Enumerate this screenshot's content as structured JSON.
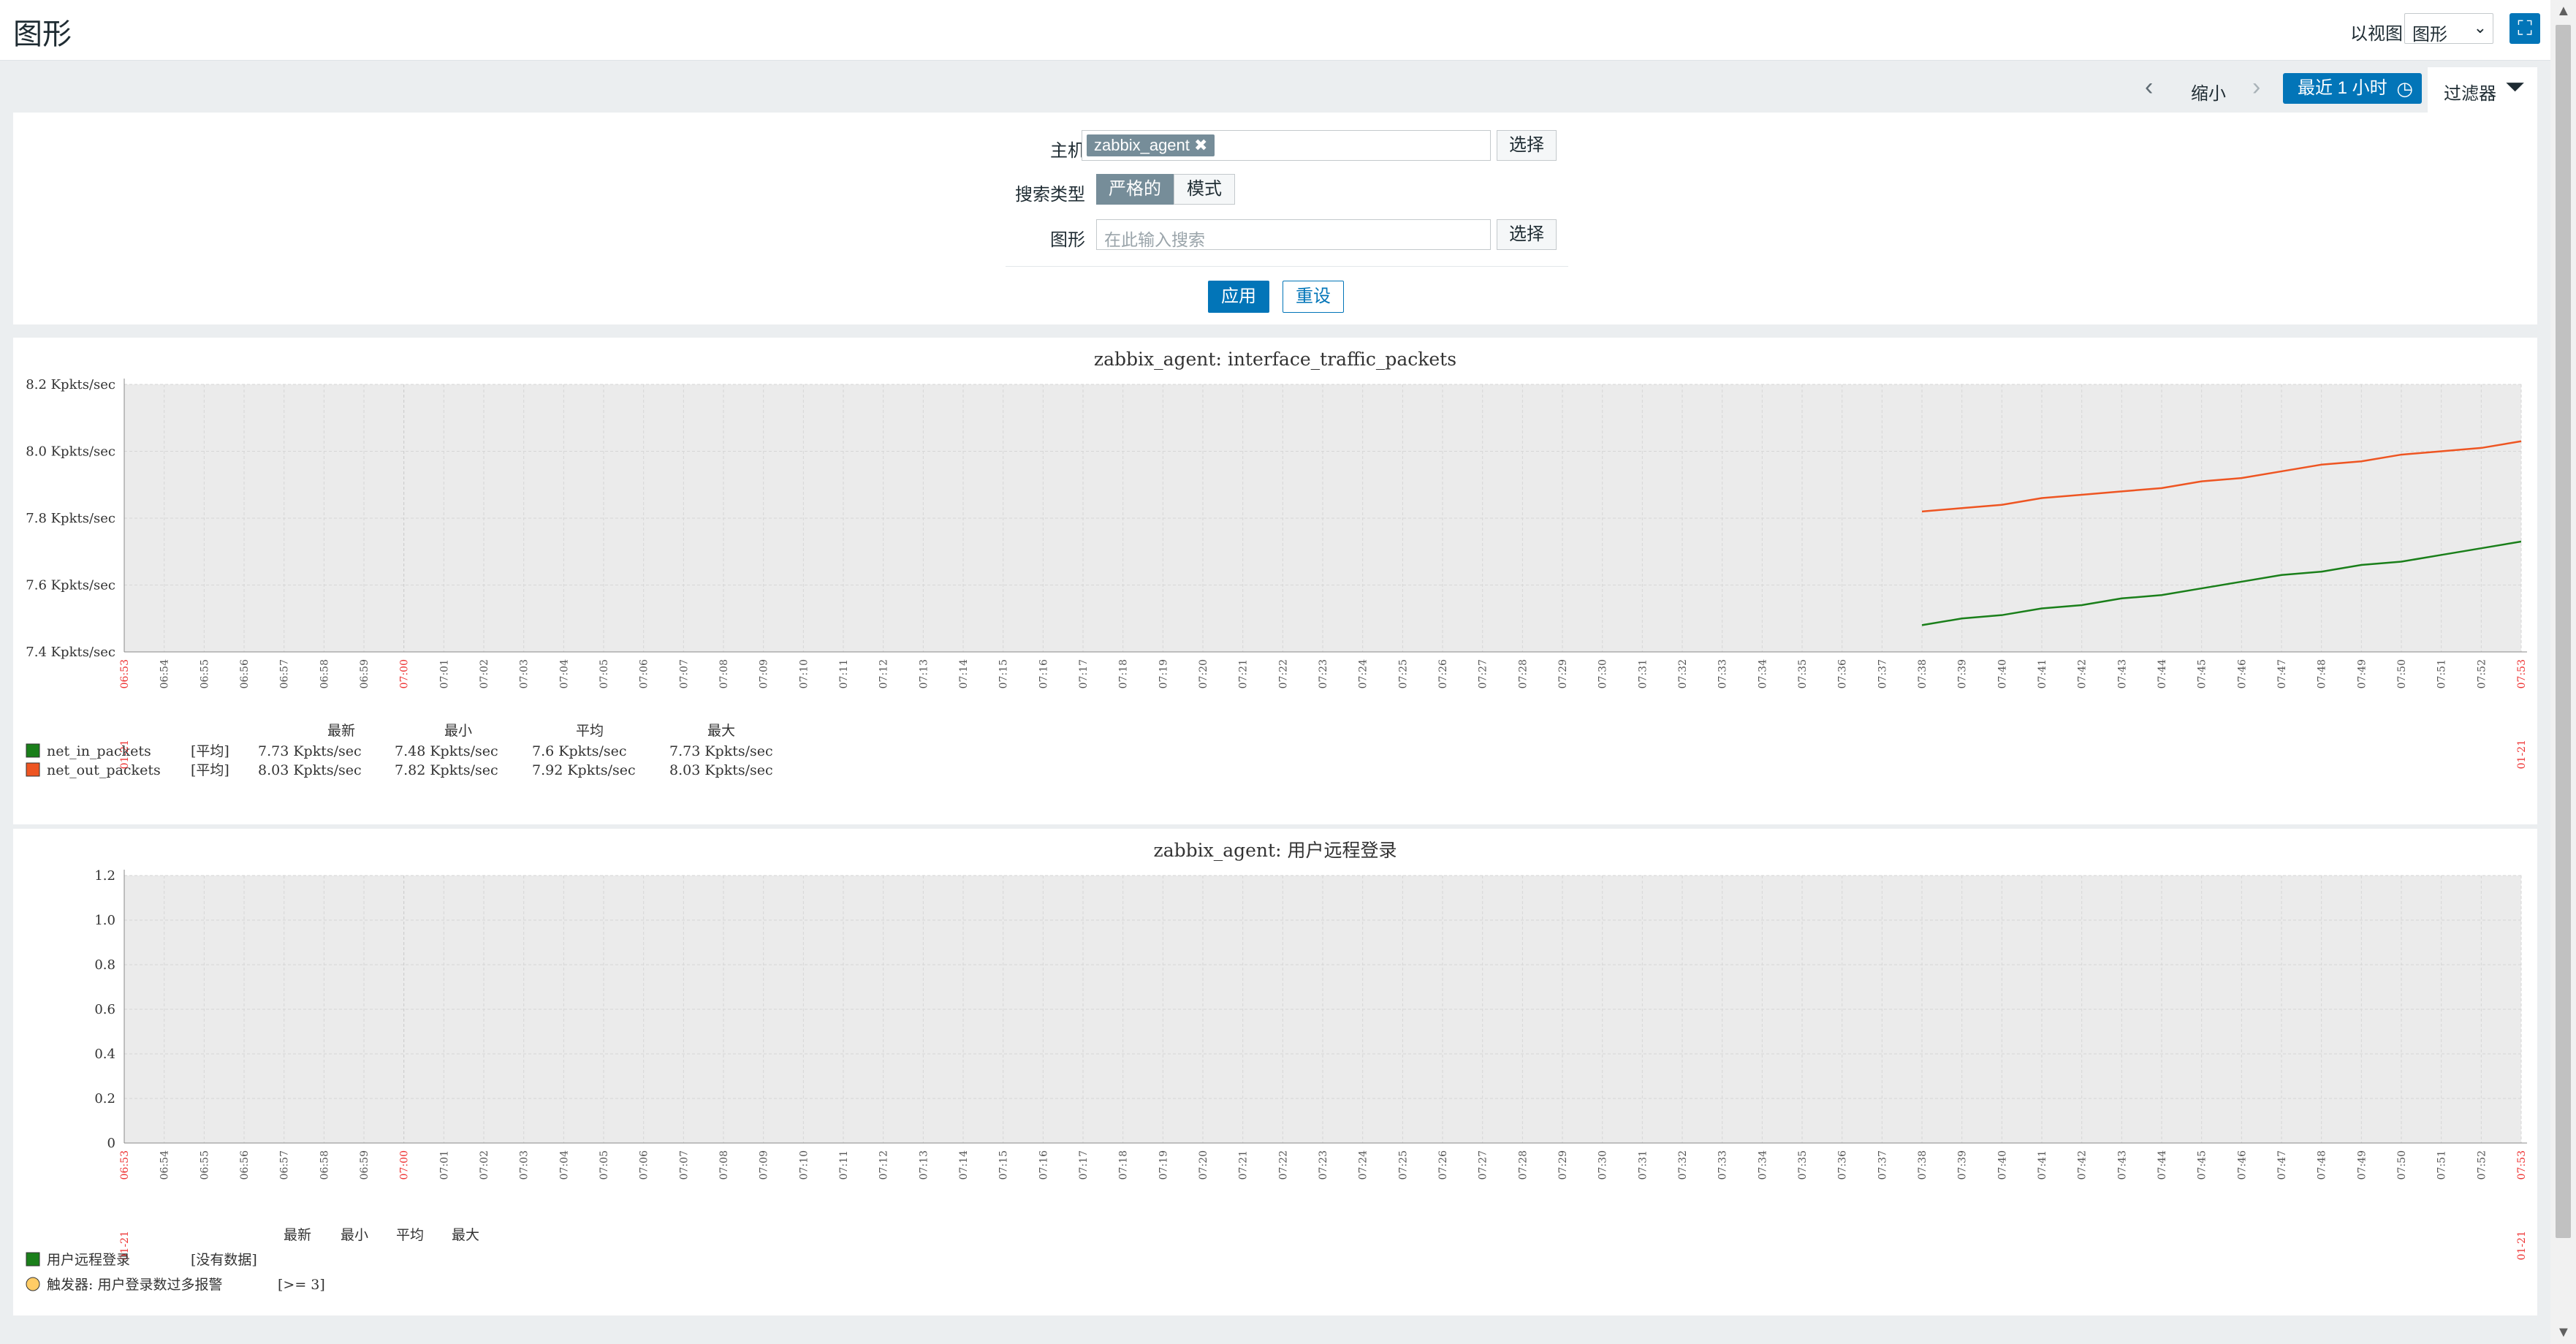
{
  "header": {
    "title": "图形",
    "view_as_label": "以视图",
    "view_as_value": "图形"
  },
  "timenav": {
    "zoom_out": "缩小",
    "period": "最近 1 小时",
    "filter": "过滤器"
  },
  "filter": {
    "host_label": "主机",
    "host_chip": "zabbix_agent",
    "select": "选择",
    "search_type_label": "搜索类型",
    "search_type_options": [
      "严格的",
      "模式"
    ],
    "search_type_selected": "严格的",
    "graph_label": "图形",
    "graph_placeholder": "在此输入搜索",
    "apply": "应用",
    "reset": "重设"
  },
  "colors": {
    "accent": "#0275b8",
    "in_packets": "#1a7f1a",
    "out_packets": "#ee5522",
    "plot_bg": "#ebebeb",
    "red_tick": "#ee3333"
  },
  "time_labels": [
    "06:53",
    "06:54",
    "06:55",
    "06:56",
    "06:57",
    "06:58",
    "06:59",
    "07:00",
    "07:01",
    "07:02",
    "07:03",
    "07:04",
    "07:05",
    "07:06",
    "07:07",
    "07:08",
    "07:09",
    "07:10",
    "07:11",
    "07:12",
    "07:13",
    "07:14",
    "07:15",
    "07:16",
    "07:17",
    "07:18",
    "07:19",
    "07:20",
    "07:21",
    "07:22",
    "07:23",
    "07:24",
    "07:25",
    "07:26",
    "07:27",
    "07:28",
    "07:29",
    "07:30",
    "07:31",
    "07:32",
    "07:33",
    "07:34",
    "07:35",
    "07:36",
    "07:37",
    "07:38",
    "07:39",
    "07:40",
    "07:41",
    "07:42",
    "07:43",
    "07:44",
    "07:45",
    "07:46",
    "07:47",
    "07:48",
    "07:49",
    "07:50",
    "07:51",
    "07:52",
    "07:53"
  ],
  "date_label": "01-21",
  "graphs": [
    {
      "title": "zabbix_agent: interface_traffic_packets",
      "y_ticks": [
        "8.2 Kpkts/sec",
        "8.0 Kpkts/sec",
        "7.8 Kpkts/sec",
        "7.6 Kpkts/sec",
        "7.4 Kpkts/sec"
      ],
      "y_range": [
        7.4,
        8.2
      ],
      "legend_headers": [
        "最新",
        "最小",
        "平均",
        "最大"
      ],
      "legend": [
        {
          "name": "net_in_packets",
          "func": "[平均]",
          "last": "7.73 Kpkts/sec",
          "min": "7.48 Kpkts/sec",
          "avg": "7.6 Kpkts/sec",
          "max": "7.73 Kpkts/sec",
          "color": "#1a7f1a"
        },
        {
          "name": "net_out_packets",
          "func": "[平均]",
          "last": "8.03 Kpkts/sec",
          "min": "7.82 Kpkts/sec",
          "avg": "7.92 Kpkts/sec",
          "max": "8.03 Kpkts/sec",
          "color": "#ee5522"
        }
      ],
      "chart_data": {
        "type": "line",
        "x": [
          "07:38",
          "07:39",
          "07:40",
          "07:41",
          "07:42",
          "07:43",
          "07:44",
          "07:45",
          "07:46",
          "07:47",
          "07:48",
          "07:49",
          "07:50",
          "07:51",
          "07:52",
          "07:53"
        ],
        "series": [
          {
            "name": "net_in_packets",
            "values": [
              7.48,
              7.5,
              7.51,
              7.53,
              7.54,
              7.56,
              7.57,
              7.59,
              7.61,
              7.63,
              7.64,
              7.66,
              7.67,
              7.69,
              7.71,
              7.73
            ]
          },
          {
            "name": "net_out_packets",
            "values": [
              7.82,
              7.83,
              7.84,
              7.86,
              7.87,
              7.88,
              7.89,
              7.91,
              7.92,
              7.94,
              7.96,
              7.97,
              7.99,
              8.0,
              8.01,
              8.03
            ]
          }
        ],
        "ylim": [
          7.4,
          8.2
        ]
      }
    },
    {
      "title": "zabbix_agent: 用户远程登录",
      "y_ticks": [
        "1.2",
        "1.0",
        "0.8",
        "0.6",
        "0.4",
        "0.2",
        "0"
      ],
      "y_range": [
        0,
        1.2
      ],
      "legend_headers": [
        "最新",
        "最小",
        "平均",
        "最大"
      ],
      "legend": [
        {
          "name": "用户远程登录",
          "func": "[没有数据]",
          "color": "#1a7f1a"
        }
      ],
      "trigger": {
        "name": "触发器: 用户登录数过多报警",
        "cond": "[>= 3]",
        "color": "#ffcc66"
      },
      "chart_data": {
        "type": "line",
        "x": [],
        "series": [],
        "ylim": [
          0,
          1.2
        ]
      }
    }
  ]
}
